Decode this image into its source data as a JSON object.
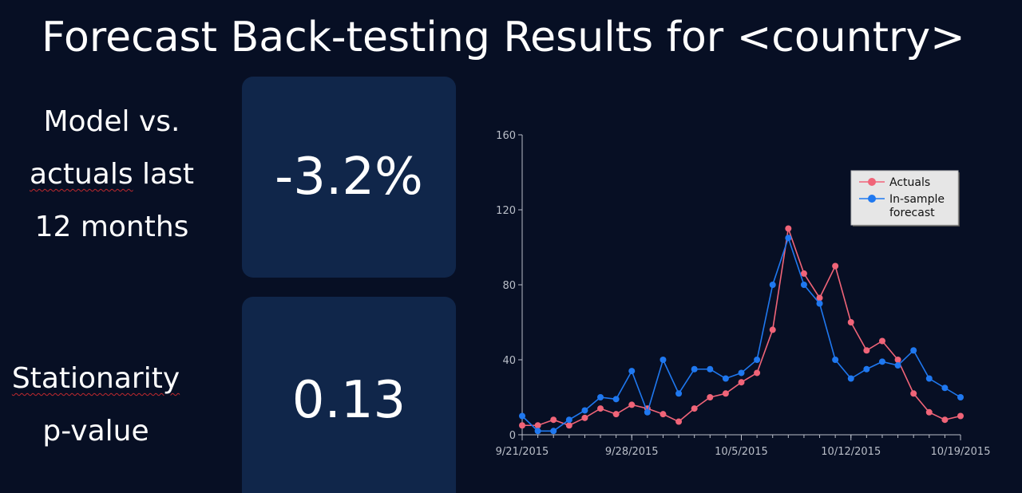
{
  "title": "Forecast Back-testing Results for <country>",
  "metrics": [
    {
      "label_lines": [
        "Model vs.",
        "actuals last",
        "12 months"
      ],
      "value": "-3.2%"
    },
    {
      "label_lines": [
        "Stationarity",
        "p-value"
      ],
      "value": "0.13"
    }
  ],
  "colors": {
    "background": "#070f24",
    "card": "#10264a",
    "actuals": "#f06478",
    "forecast": "#1f78f0",
    "axis": "#b9bec8"
  },
  "chart_data": {
    "type": "line",
    "x": [
      "9/21/2015",
      "9/22/2015",
      "9/23/2015",
      "9/24/2015",
      "9/25/2015",
      "9/26/2015",
      "9/27/2015",
      "9/28/2015",
      "9/29/2015",
      "9/30/2015",
      "10/1/2015",
      "10/2/2015",
      "10/3/2015",
      "10/4/2015",
      "10/5/2015",
      "10/6/2015",
      "10/7/2015",
      "10/8/2015",
      "10/9/2015",
      "10/10/2015",
      "10/11/2015",
      "10/12/2015",
      "10/13/2015",
      "10/14/2015",
      "10/15/2015",
      "10/16/2015",
      "10/17/2015",
      "10/18/2015",
      "10/19/2015"
    ],
    "x_tick_labels": [
      "9/21/2015",
      "9/28/2015",
      "10/5/2015",
      "10/12/2015",
      "10/19/2015"
    ],
    "y_ticks": [
      0,
      40,
      80,
      120,
      160
    ],
    "ylim": [
      0,
      160
    ],
    "series": [
      {
        "name": "Actuals",
        "values": [
          5,
          5,
          8,
          5,
          9,
          14,
          11,
          16,
          14,
          11,
          7,
          14,
          20,
          22,
          28,
          33,
          56,
          110,
          86,
          73,
          90,
          60,
          45,
          50,
          40,
          22,
          12,
          8,
          10
        ]
      },
      {
        "name": "In-sample forecast",
        "values": [
          10,
          2,
          2,
          8,
          13,
          20,
          19,
          34,
          12,
          40,
          22,
          35,
          35,
          30,
          33,
          40,
          80,
          105,
          80,
          70,
          40,
          30,
          35,
          39,
          37,
          45,
          30,
          25,
          20
        ]
      }
    ],
    "legend_position": "top-right",
    "grid": false
  }
}
